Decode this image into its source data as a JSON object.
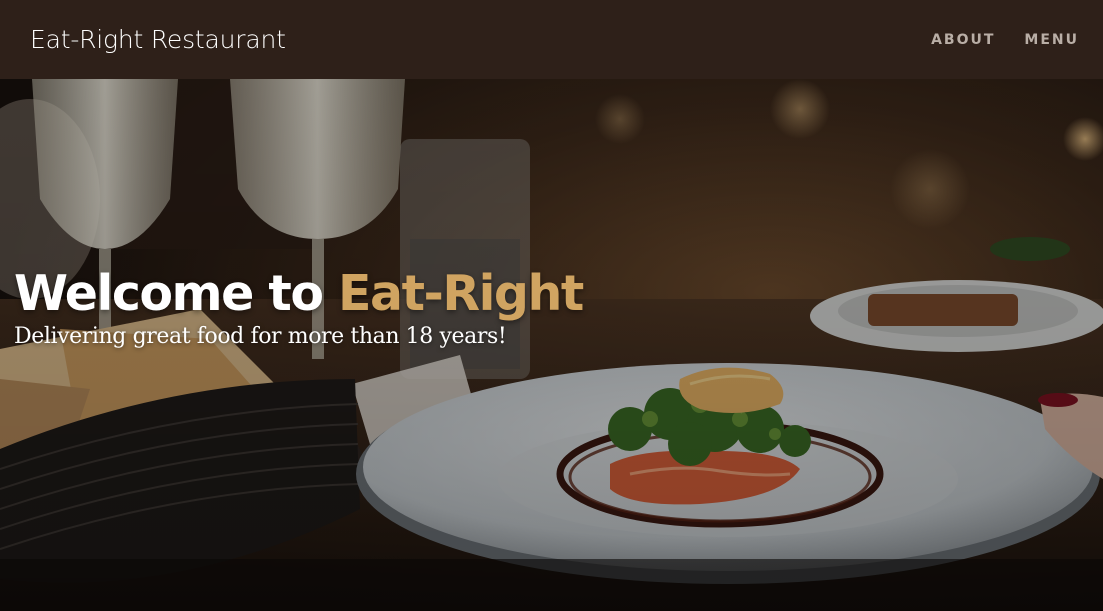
{
  "navbar": {
    "brand": "Eat-Right Restaurant",
    "links": [
      {
        "label": "ABOUT"
      },
      {
        "label": "MENU"
      }
    ]
  },
  "hero": {
    "title_prefix": "Welcome to ",
    "title_accent": "Eat-Right",
    "subtitle": "Delivering great food for more than 18 years!",
    "image_subject": "restaurant table with plated dish, bread basket and wine glasses"
  },
  "colors": {
    "navbar_bg": "#2e2019",
    "accent": "#d0a461",
    "nav_link": "#b9aea6",
    "text": "#ffffff"
  }
}
